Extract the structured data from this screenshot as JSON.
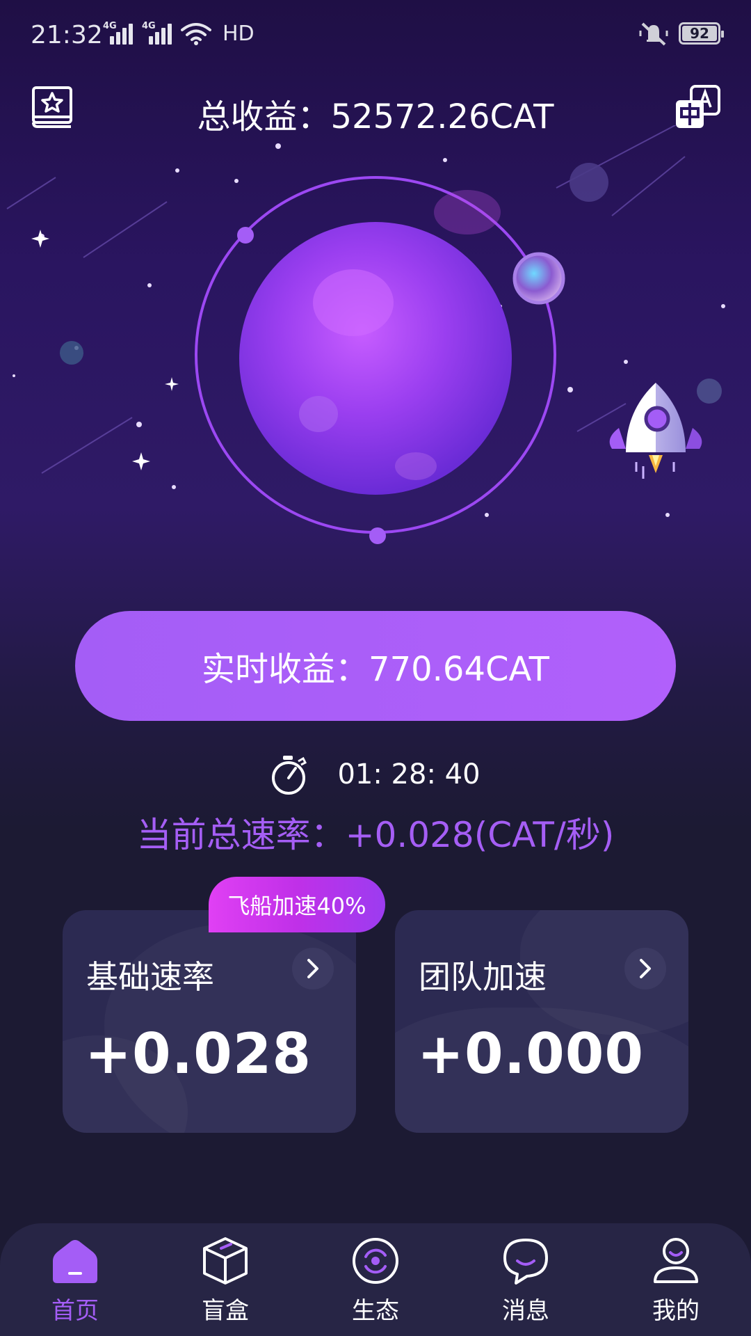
{
  "status_bar": {
    "time": "21:32",
    "signal_1_tag": "4G",
    "signal_2_tag": "4G",
    "hd": "HD",
    "battery": "92"
  },
  "header": {
    "title": "总收益：52572.26CAT",
    "left_icon": "favorites-book-icon",
    "right_icon": "language-translate-icon"
  },
  "realtime": {
    "label": "实时收益：770.64CAT"
  },
  "timer": {
    "value": "01: 28: 40",
    "icon": "stopwatch-icon"
  },
  "rate": {
    "text": "当前总速率：+0.028(CAT/秒)"
  },
  "boost_badge": "飞船加速40%",
  "cards": [
    {
      "title": "基础速率",
      "value": "+0.028"
    },
    {
      "title": "团队加速",
      "value": "+0.000"
    }
  ],
  "nav": [
    {
      "label": "首页",
      "icon": "home-icon",
      "active": true
    },
    {
      "label": "盲盒",
      "icon": "box-icon",
      "active": false
    },
    {
      "label": "生态",
      "icon": "ecology-icon",
      "active": false
    },
    {
      "label": "消息",
      "icon": "message-icon",
      "active": false
    },
    {
      "label": "我的",
      "icon": "profile-icon",
      "active": false
    }
  ],
  "colors": {
    "accent": "#a45df6",
    "card": "#2c2a52",
    "nav_bg": "#272545"
  }
}
